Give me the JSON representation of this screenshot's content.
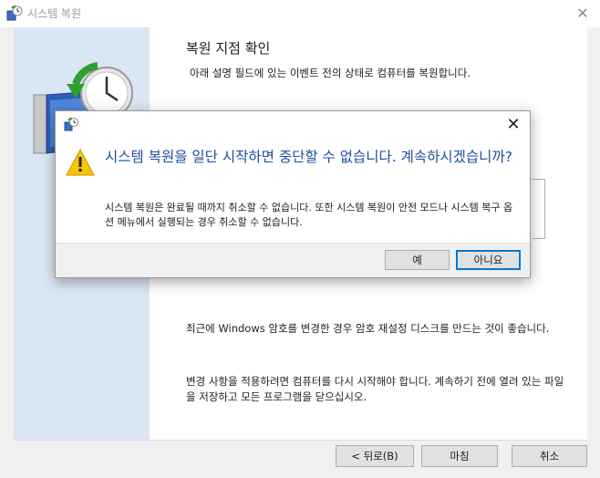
{
  "window": {
    "title": "시스템 복원",
    "heading": "복원 지점 확인",
    "subheading": "아래 설명 필드에 있는 이벤트 전의 상태로 컴퓨터를 복원합니다.",
    "paragraph1": "최근에 Windows 암호를 변경한 경우 암호 재설정 디스크를 만드는 것이 좋습니다.",
    "paragraph2": "변경 사항을 적용하려면 컴퓨터를 다시 시작해야 합니다. 계속하기 전에 열려 있는 파일을 저장하고 모든 프로그램을 닫으십시오.",
    "buttons": {
      "back": "< 뒤로(B)",
      "finish": "마침",
      "cancel": "취소"
    }
  },
  "dialog": {
    "main_instruction": "시스템 복원을 일단 시작하면 중단할 수 없습니다. 계속하시겠습니까?",
    "detail": "시스템 복원은 완료될 때까지 취소할 수 없습니다. 또한 시스템 복원이 안전 모드나 시스템 복구 옵션 메뉴에서 실행되는 경우 취소할 수 없습니다.",
    "buttons": {
      "yes": "예",
      "no": "아니요"
    }
  },
  "icons": {
    "close": "✕",
    "app": "system-restore-icon",
    "warning": "warning-icon"
  },
  "colors": {
    "main_instruction": "#1b4fa0",
    "side_panel": "#dbe6f4",
    "focus_border": "#0078d7"
  }
}
